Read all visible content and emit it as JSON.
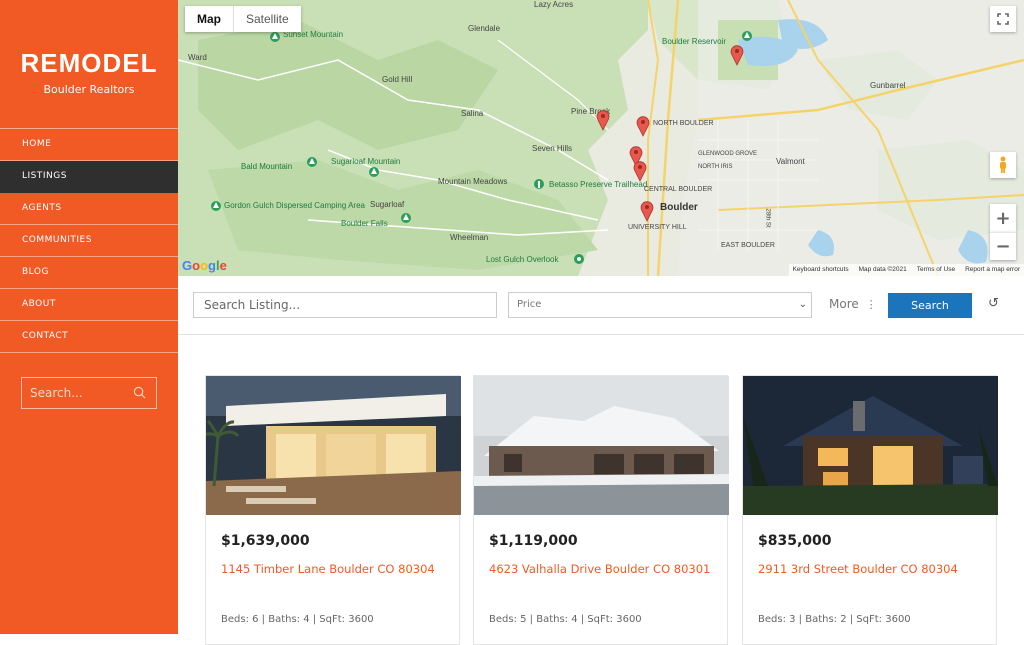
{
  "sidebar": {
    "logo": "REMODEL",
    "tagline": "Boulder Realtors",
    "nav": [
      {
        "label": "HOME",
        "active": false
      },
      {
        "label": "LISTINGS",
        "active": true
      },
      {
        "label": "AGENTS",
        "active": false
      },
      {
        "label": "COMMUNITIES",
        "active": false
      },
      {
        "label": "BLOG",
        "active": false
      },
      {
        "label": "ABOUT",
        "active": false
      },
      {
        "label": "CONTACT",
        "active": false
      }
    ],
    "search_placeholder": "Search..."
  },
  "map": {
    "type_map": "Map",
    "type_satellite": "Satellite",
    "google": "Google",
    "footer": [
      "Keyboard shortcuts",
      "Map data ©2021",
      "Terms of Use",
      "Report a map error"
    ],
    "labels": {
      "lazy_acres": "Lazy Acres",
      "glendale": "Glendale",
      "ward": "Ward",
      "sunset_mountain": "Sunset Mountain",
      "gold_hill": "Gold Hill",
      "salina": "Salina",
      "pine_brook": "Pine Brook",
      "north_boulder": "NORTH BOULDER",
      "seven_hills": "Seven Hills",
      "bald_mountain": "Bald Mountain",
      "sugarloaf_mountain": "Sugarloaf Mountain",
      "mountain_meadows": "Mountain Meadows",
      "betasso": "Betasso Preserve Trailhead",
      "central_boulder": "CENTRAL BOULDER",
      "boulder": "Boulder",
      "gordon_gulch": "Gordon Gulch Dispersed Camping Area",
      "sugarloaf": "Sugarloaf",
      "boulder_falls": "Boulder Falls",
      "wheelman": "Wheelman",
      "university_hill": "UNIVERSITY HILL",
      "lost_gulch": "Lost Gulch Overlook",
      "east_boulder": "EAST BOULDER",
      "boulder_reservoir": "Boulder Reservoir",
      "gunbarrel": "Gunbarrel",
      "valmont": "Valmont",
      "glenwood_grove": "GLENWOOD GROVE",
      "north_iris": "NORTH IRIS",
      "28th_st": "28th St"
    }
  },
  "filter": {
    "search_placeholder": "Search Listing...",
    "price_placeholder": "Price",
    "more_label": "More",
    "search_button": "Search"
  },
  "listings": [
    {
      "price": "$1,639,000",
      "address": "1145 Timber Lane Boulder CO 80304",
      "meta": "Beds: 6 | Baths: 4 | SqFt: 3600"
    },
    {
      "price": "$1,119,000",
      "address": "4623 Valhalla Drive Boulder CO 80301",
      "meta": "Beds: 5 | Baths: 4 | SqFt: 3600"
    },
    {
      "price": "$835,000",
      "address": "2911 3rd Street Boulder CO 80304",
      "meta": "Beds: 3 | Baths: 2 | SqFt: 3600"
    }
  ]
}
